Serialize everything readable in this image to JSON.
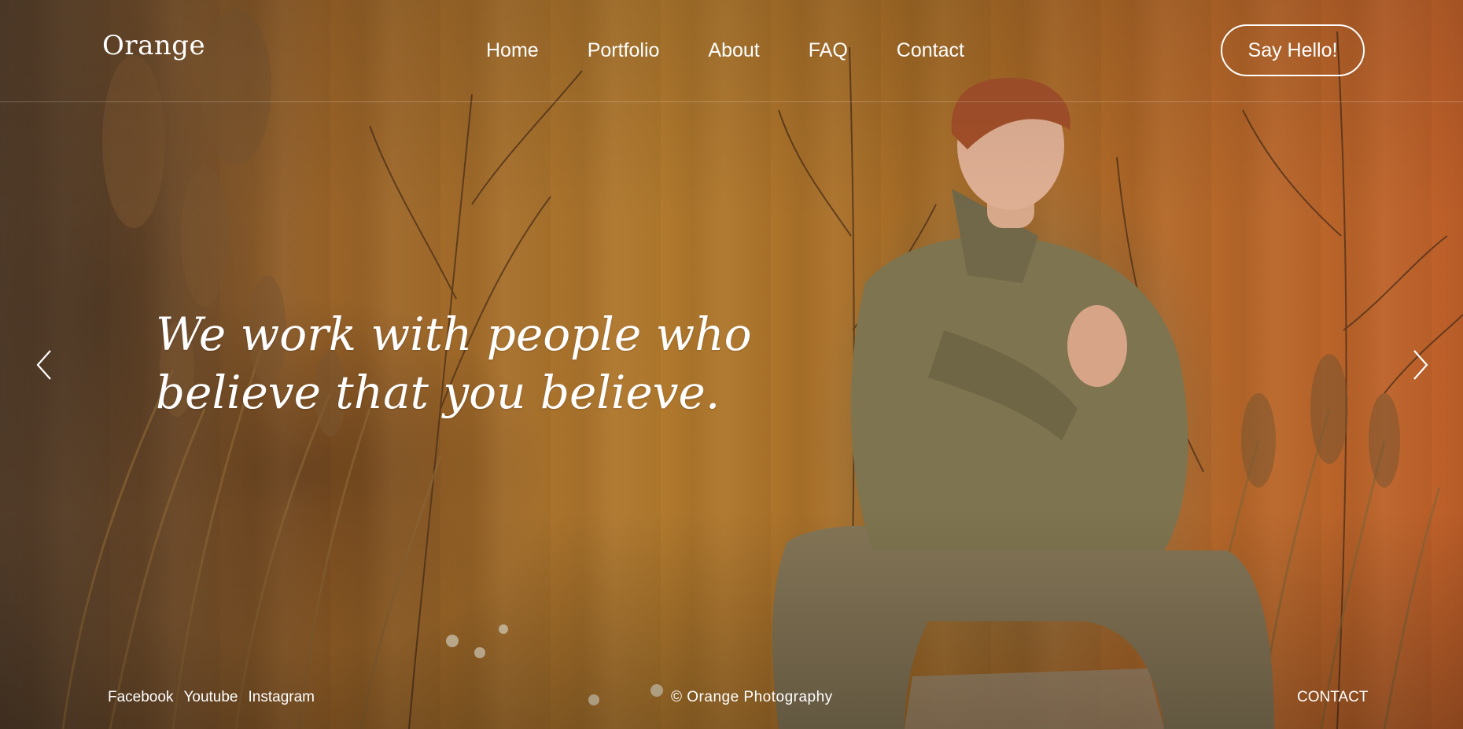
{
  "brand": {
    "logo_text": "Orange"
  },
  "nav": {
    "items": [
      {
        "label": "Home"
      },
      {
        "label": "Portfolio"
      },
      {
        "label": "About"
      },
      {
        "label": "FAQ"
      },
      {
        "label": "Contact"
      }
    ],
    "cta_label": "Say Hello!"
  },
  "hero": {
    "headline_line1": "We work with people who",
    "headline_line2": "believe that you believe.",
    "prev_icon": "chevron-left-icon",
    "next_icon": "chevron-right-icon"
  },
  "footer": {
    "social": [
      {
        "label": "Facebook"
      },
      {
        "label": "Youtube"
      },
      {
        "label": "Instagram"
      }
    ],
    "copyright": "© Orange Photography",
    "contact_label": "CONTACT"
  },
  "colors": {
    "text": "#ffffff",
    "background_warm": "#b27a2e",
    "background_right": "#c0602a"
  }
}
